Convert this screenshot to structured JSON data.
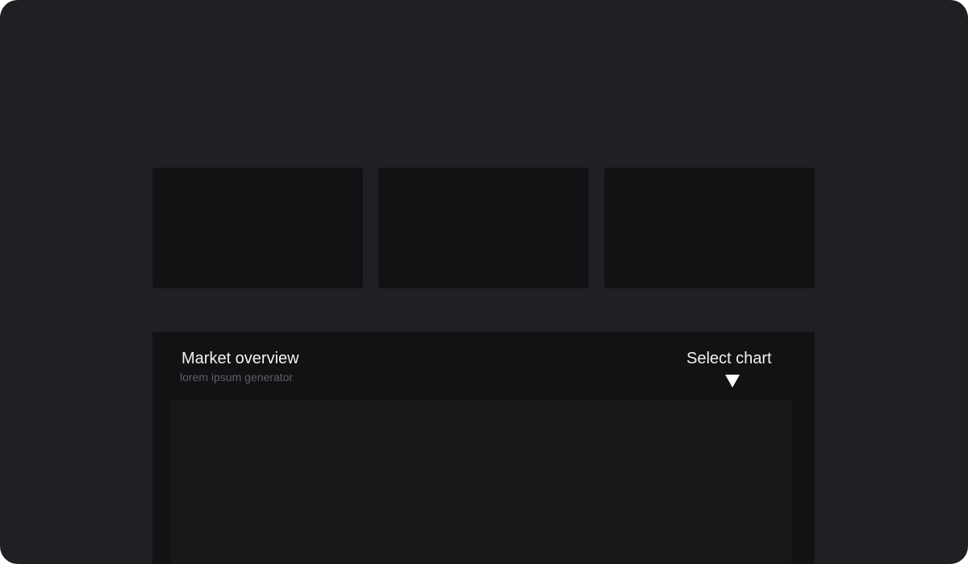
{
  "stat_cards": [
    {},
    {},
    {}
  ],
  "market_panel": {
    "title": "Market overview",
    "subtitle": "lorem ipsum generator",
    "chart_select": {
      "label": "Select chart",
      "icon": "chevron-down-icon"
    }
  },
  "colors": {
    "background": "#202024",
    "card": "#121214",
    "chart_area": "#18181a",
    "text_primary": "#f2f2f4",
    "text_muted": "#5e5e66"
  }
}
